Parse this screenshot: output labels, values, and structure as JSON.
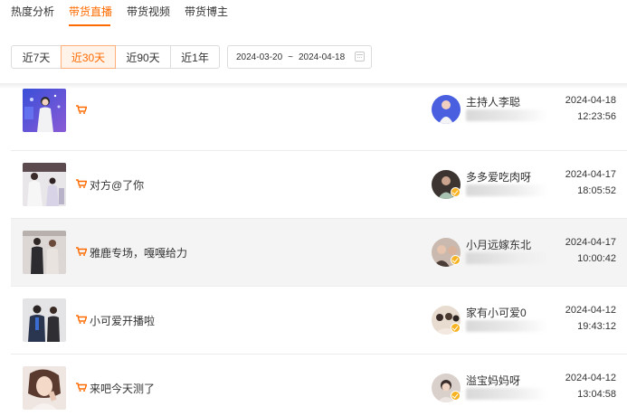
{
  "tabs": [
    {
      "label": "热度分析"
    },
    {
      "label": "带货直播"
    },
    {
      "label": "带货视频"
    },
    {
      "label": "带货博主"
    }
  ],
  "active_tab": "带货直播",
  "ranges": [
    {
      "label": "近7天"
    },
    {
      "label": "近30天"
    },
    {
      "label": "近90天"
    },
    {
      "label": "近1年"
    }
  ],
  "active_range": "近30天",
  "date_range": {
    "start": "2024-03-20",
    "separator": "~",
    "end": "2024-04-18"
  },
  "colors": {
    "accent": "#ff6a00",
    "row_highlight": "#f4f4f4",
    "badge": "#f7b321"
  },
  "rows": [
    {
      "title": "",
      "author": "主持人李聪",
      "date": "2024-04-18",
      "time": "12:23:56"
    },
    {
      "title": "对方@了你",
      "author": "多多爱吃肉呀",
      "date": "2024-04-17",
      "time": "18:05:52"
    },
    {
      "title": "雅鹿专场，嘎嘎给力",
      "author": "小月远嫁东北",
      "date": "2024-04-17",
      "time": "10:00:42"
    },
    {
      "title": "小可爱开播啦",
      "author": "家有小可爱0",
      "date": "2024-04-12",
      "time": "19:43:12"
    },
    {
      "title": "来吧今天测了",
      "author": "溢宝妈妈呀",
      "date": "2024-04-12",
      "time": "13:04:58"
    }
  ]
}
